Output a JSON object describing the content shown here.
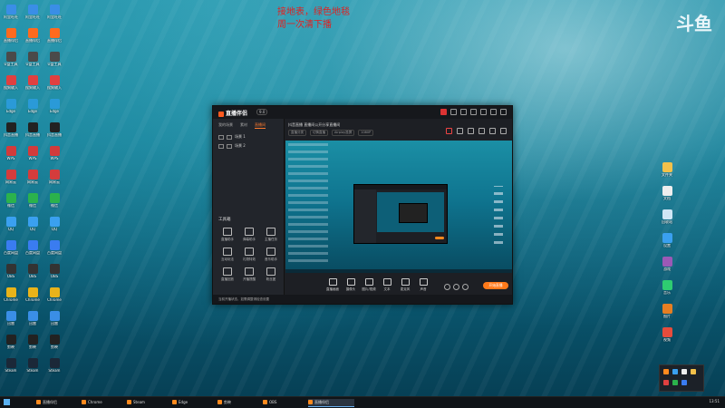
{
  "overlay_text": {
    "line1": "接地表，绿色地毯",
    "line2": "周一次清下播"
  },
  "logo_text": "斗鱼",
  "desktop_icons_left": [
    {
      "label": "阿里旺旺",
      "color": "#3a8ee6"
    },
    {
      "label": "直播伴侣",
      "color": "#ff6a1e"
    },
    {
      "label": "U盘工具",
      "color": "#4a4a4a"
    },
    {
      "label": "搜狗输入",
      "color": "#e04040"
    },
    {
      "label": "Edge",
      "color": "#2a9ad8"
    },
    {
      "label": "抖音直播",
      "color": "#222"
    },
    {
      "label": "WPS",
      "color": "#d23b3b"
    },
    {
      "label": "网易云",
      "color": "#d43c3c"
    },
    {
      "label": "微信",
      "color": "#2bb24c"
    },
    {
      "label": "QQ",
      "color": "#3aa0f0"
    },
    {
      "label": "百度网盘",
      "color": "#3a7cf0"
    },
    {
      "label": "OBS",
      "color": "#333"
    },
    {
      "label": "Chrome",
      "color": "#e8b31a"
    },
    {
      "label": "迅雷",
      "color": "#3a8ee6"
    },
    {
      "label": "剪映",
      "color": "#222"
    },
    {
      "label": "Steam",
      "color": "#1b2838"
    }
  ],
  "desktop_icons_right": [
    {
      "label": "文件夹",
      "color": "#f3c14a"
    },
    {
      "label": "文档",
      "color": "#eee"
    },
    {
      "label": "回收站",
      "color": "#cfe6f5"
    },
    {
      "label": "设置",
      "color": "#3aa0f0"
    },
    {
      "label": "游戏",
      "color": "#9b59b6"
    },
    {
      "label": "音乐",
      "color": "#2ecc71"
    },
    {
      "label": "图片",
      "color": "#e67e22"
    },
    {
      "label": "视频",
      "color": "#e74c3c"
    }
  ],
  "app": {
    "name": "直播伴侣",
    "version": "9.0",
    "left_tabs": [
      "我的场景",
      "素材",
      "直播间"
    ],
    "scenes": [
      "场景 1",
      "场景 2"
    ],
    "tools_title": "工具箱",
    "tools": [
      "直播助手",
      "弹幕助手",
      "主播任务",
      "互动玩法",
      "礼物特效",
      "音乐助手",
      "直播回放",
      "开播提醒",
      "粉丝团"
    ],
    "room_title": "抖音直播 直播间公开分享直播间",
    "room_meta": [
      "直播分类",
      "切换直播",
      "Airplay投屏",
      "1080P"
    ],
    "controls": [
      "直播画面",
      "摄像头",
      "图片/视频",
      "文本",
      "麦克风",
      "声音"
    ],
    "go_live": "开始直播",
    "status": "当前开播状态，如需调整请检查设置"
  },
  "taskbar": {
    "items": [
      "直播伴侣",
      "Chrome",
      "Steam",
      "Edge",
      "剪映",
      "OBS",
      "直播伴侣"
    ],
    "active_index": 6,
    "clock": "13:51"
  }
}
